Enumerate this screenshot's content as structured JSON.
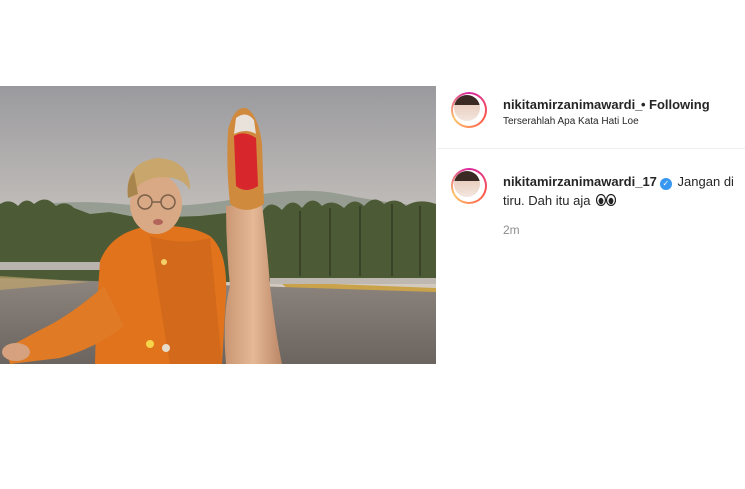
{
  "post": {
    "photo_alt": "",
    "owner": {
      "username": "nikitamirzanimawardi_",
      "follow_status": "Following",
      "separator": "•",
      "subtitle": "Terserahlah Apa Kata Hati Loe"
    },
    "caption": {
      "username": "nikitamirzanimawardi_17",
      "verified": true,
      "text_line1": "Jangan",
      "text_rest": "di tiru. Dah itu aja",
      "emoji_icon": "eyes-icon",
      "time": "2m"
    }
  },
  "colors": {
    "verified_badge": "#3897f0",
    "sweater": "#e0731c",
    "shoe_sole": "#d7262c",
    "timestamp": "#8e8e8e"
  }
}
